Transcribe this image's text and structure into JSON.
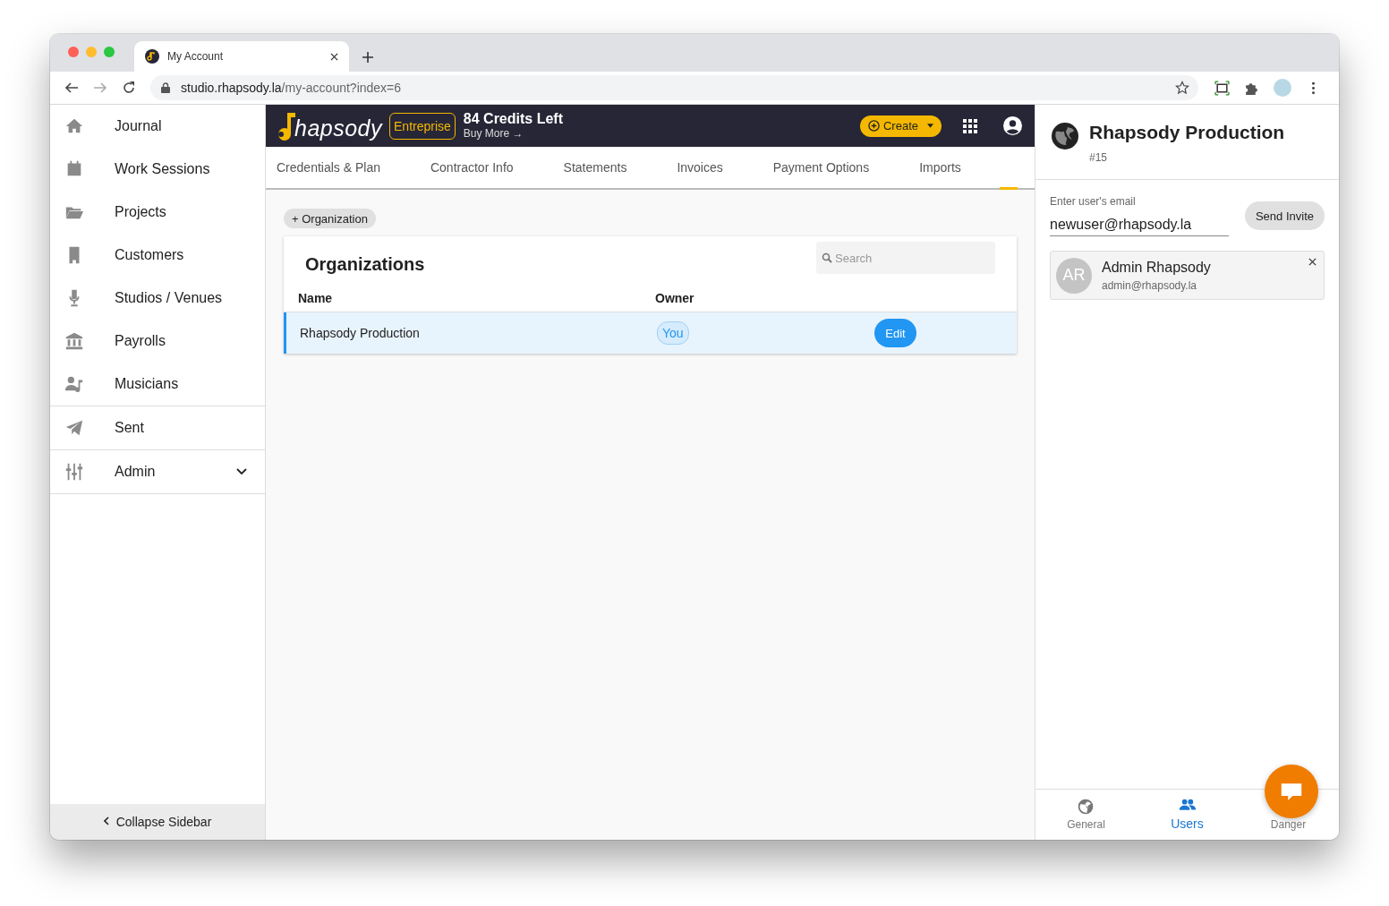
{
  "browser": {
    "tab_title": "My Account",
    "url_host": "studio.rhapsody.la",
    "url_path": "/my-account?index=6"
  },
  "sidebar": {
    "sections": [
      [
        {
          "label": "Journal"
        },
        {
          "label": "Work Sessions"
        },
        {
          "label": "Projects"
        },
        {
          "label": "Customers"
        },
        {
          "label": "Studios / Venues"
        },
        {
          "label": "Payrolls"
        },
        {
          "label": "Musicians"
        }
      ],
      [
        {
          "label": "Sent"
        }
      ],
      [
        {
          "label": "Admin",
          "expanded": false
        }
      ]
    ],
    "collapse": "Collapse Sidebar"
  },
  "header": {
    "logo": "hapsody",
    "plan": "Entreprise",
    "credits": "84 Credits Left",
    "buy_more": "Buy More →",
    "create": "Create"
  },
  "tabs": [
    {
      "label": "Credentials & Plan",
      "selected": false
    },
    {
      "label": "Contractor Info",
      "selected": false
    },
    {
      "label": "Statements",
      "selected": false
    },
    {
      "label": "Invoices",
      "selected": false
    },
    {
      "label": "Payment Options",
      "selected": false
    },
    {
      "label": "Imports",
      "selected": false
    },
    {
      "selected": true
    }
  ],
  "add_button": "+ Organization",
  "organizations": {
    "title": "Organizations",
    "search": {
      "placeholder": "Search"
    },
    "columns": [
      "Name",
      "Owner"
    ],
    "rows": [
      {
        "name": "Rhapsody Production",
        "owner": "You",
        "action": "Edit",
        "selected": true
      }
    ]
  },
  "panel": {
    "title": "Rhapsody Production",
    "subtitle": "#15",
    "email_field": {
      "label": "Enter user's email",
      "value": "newuser@rhapsody.la"
    },
    "send": "Send Invite",
    "users": [
      {
        "initials": "AR",
        "name": "Admin Rhapsody",
        "email": "admin@rhapsody.la"
      }
    ],
    "nav": [
      {
        "label": "General",
        "selected": false
      },
      {
        "label": "Users",
        "selected": true
      },
      {
        "label": "Danger",
        "selected": false
      }
    ]
  }
}
